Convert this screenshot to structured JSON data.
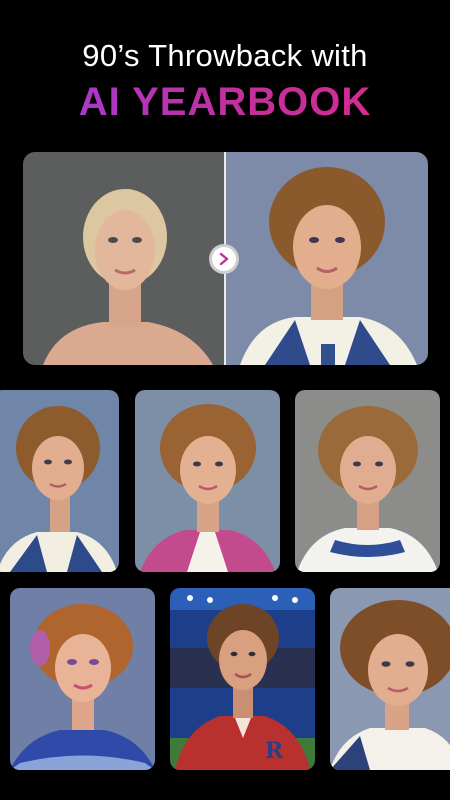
{
  "header": {
    "headline": "90’s Throwback with",
    "brand": "AI YEARBOOK"
  },
  "colors": {
    "background": "#000000",
    "brand_gradient_start": "#9b3fe0",
    "brand_gradient_end": "#e0288a"
  },
  "compare": {
    "button_icon": "chevron-right-icon"
  }
}
